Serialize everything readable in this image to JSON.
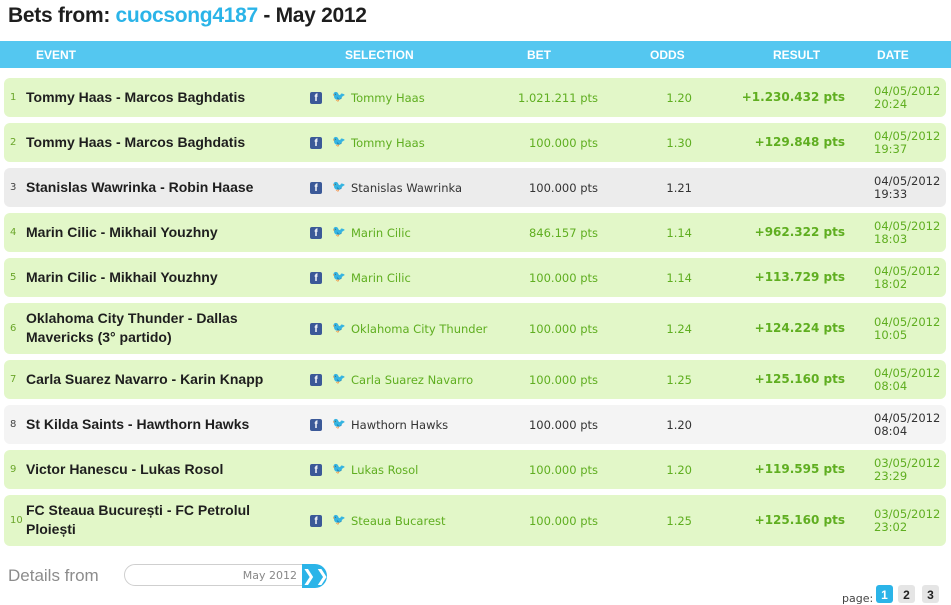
{
  "title": {
    "prefix": "Bets from: ",
    "user": "cuocsong4187",
    "suffix": " - May 2012"
  },
  "columns": {
    "event": "EVENT",
    "selection": "SELECTION",
    "bet": "BET",
    "odds": "ODDS",
    "result": "RESULT",
    "date": "DATE"
  },
  "rows": [
    {
      "idx": "1",
      "event": "Tommy Haas - Marcos Baghdatis",
      "selection": "Tommy Haas",
      "bet": "1.021.211 pts",
      "odds": "1.20",
      "result": "+1.230.432 pts",
      "date": "04/05/2012",
      "time": "20:24",
      "status": "win"
    },
    {
      "idx": "2",
      "event": "Tommy Haas - Marcos Baghdatis",
      "selection": "Tommy Haas",
      "bet": "100.000 pts",
      "odds": "1.30",
      "result": "+129.848 pts",
      "date": "04/05/2012",
      "time": "19:37",
      "status": "win"
    },
    {
      "idx": "3",
      "event": "Stanislas Wawrinka - Robin Haase",
      "selection": "Stanislas Wawrinka",
      "bet": "100.000 pts",
      "odds": "1.21",
      "result": "",
      "date": "04/05/2012",
      "time": "19:33",
      "status": "neutral"
    },
    {
      "idx": "4",
      "event": "Marin Cilic - Mikhail Youzhny",
      "selection": "Marin Cilic",
      "bet": "846.157 pts",
      "odds": "1.14",
      "result": "+962.322 pts",
      "date": "04/05/2012",
      "time": "18:03",
      "status": "win"
    },
    {
      "idx": "5",
      "event": "Marin Cilic - Mikhail Youzhny",
      "selection": "Marin Cilic",
      "bet": "100.000 pts",
      "odds": "1.14",
      "result": "+113.729 pts",
      "date": "04/05/2012",
      "time": "18:02",
      "status": "win"
    },
    {
      "idx": "6",
      "event": "Oklahoma City Thunder - Dallas Mavericks (3° partido)",
      "selection": "Oklahoma City Thunder",
      "bet": "100.000 pts",
      "odds": "1.24",
      "result": "+124.224 pts",
      "date": "04/05/2012",
      "time": "10:05",
      "status": "win"
    },
    {
      "idx": "7",
      "event": "Carla Suarez Navarro - Karin Knapp",
      "selection": "Carla Suarez Navarro",
      "bet": "100.000 pts",
      "odds": "1.25",
      "result": "+125.160 pts",
      "date": "04/05/2012",
      "time": "08:04",
      "status": "win"
    },
    {
      "idx": "8",
      "event": "St Kilda Saints - Hawthorn Hawks",
      "selection": "Hawthorn Hawks",
      "bet": "100.000 pts",
      "odds": "1.20",
      "result": "",
      "date": "04/05/2012",
      "time": "08:04",
      "status": "light"
    },
    {
      "idx": "9",
      "event": "Victor Hanescu - Lukas Rosol",
      "selection": "Lukas Rosol",
      "bet": "100.000 pts",
      "odds": "1.20",
      "result": "+119.595 pts",
      "date": "03/05/2012",
      "time": "23:29",
      "status": "win"
    },
    {
      "idx": "10",
      "event": "FC Steaua București - FC Petrolul Ploiești",
      "selection": "Steaua Bucarest",
      "bet": "100.000 pts",
      "odds": "1.25",
      "result": "+125.160 pts",
      "date": "03/05/2012",
      "time": "23:02",
      "status": "win"
    }
  ],
  "details": {
    "label": "Details from",
    "value": "May 2012",
    "go": "❯❯"
  },
  "pager": {
    "label": "page:",
    "pages": [
      "1",
      "2",
      "3"
    ],
    "active": "1"
  },
  "icons": {
    "facebook": "facebook-icon",
    "twitter": "twitter-icon"
  },
  "colors": {
    "accent": "#54c7f0",
    "win_row": "#e2f7c8",
    "neutral_row": "#ececec",
    "win_text": "#5fae20"
  }
}
